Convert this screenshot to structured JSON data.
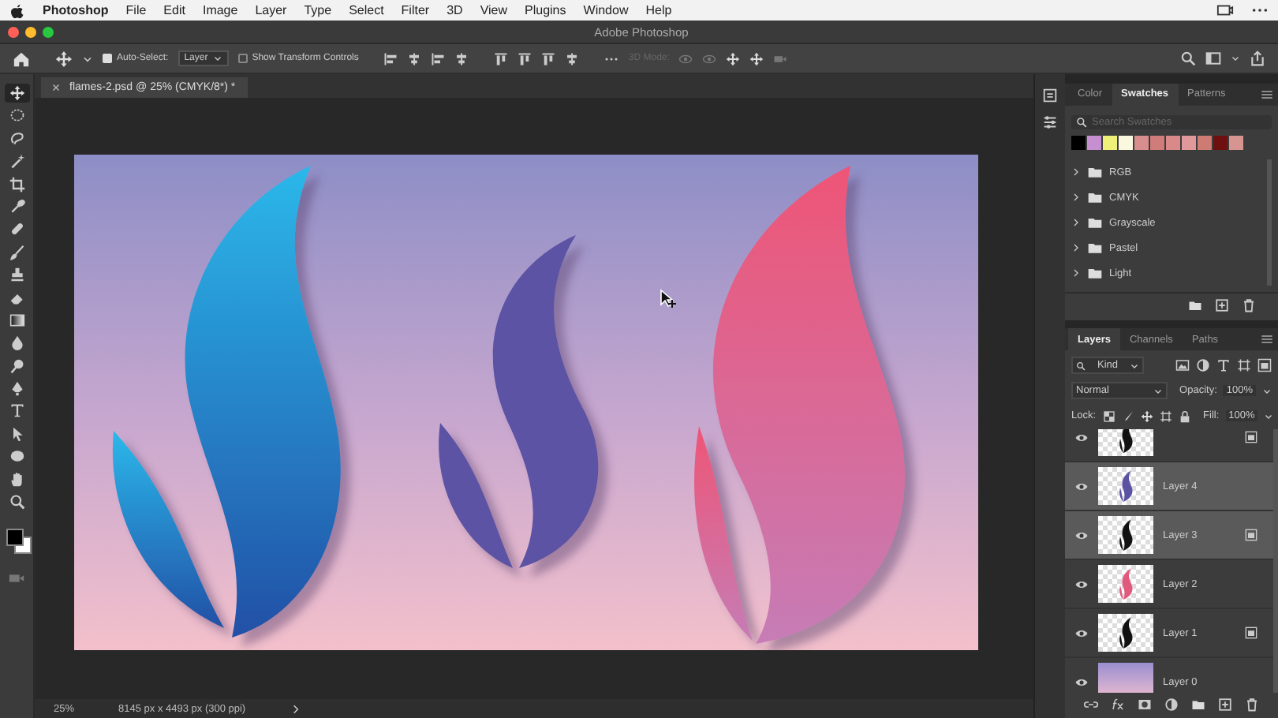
{
  "menu_bar": {
    "app_name": "Photoshop",
    "items": [
      "File",
      "Edit",
      "Image",
      "Layer",
      "Type",
      "Select",
      "Filter",
      "3D",
      "View",
      "Plugins",
      "Window",
      "Help"
    ]
  },
  "window": {
    "title": "Adobe Photoshop"
  },
  "options_bar": {
    "auto_select": {
      "label": "Auto-Select:",
      "checked": true
    },
    "target": "Layer",
    "transform_controls": {
      "label": "Show Transform Controls",
      "checked": false
    },
    "mode_3d": {
      "label": "3D Mode:",
      "disabled": true
    }
  },
  "tools": [
    {
      "kind": "move",
      "selected": true
    },
    {
      "kind": "marquee",
      "selected": false
    },
    {
      "kind": "lasso",
      "selected": false
    },
    {
      "kind": "wand",
      "selected": false
    },
    {
      "kind": "crop",
      "selected": false
    },
    {
      "kind": "eyedropper",
      "selected": false
    },
    {
      "kind": "bandage",
      "selected": false
    },
    {
      "kind": "brush",
      "selected": false
    },
    {
      "kind": "stamp",
      "selected": false
    },
    {
      "kind": "eraser",
      "selected": false
    },
    {
      "kind": "gradient",
      "selected": false
    },
    {
      "kind": "drop",
      "selected": false
    },
    {
      "kind": "dodge",
      "selected": false
    },
    {
      "kind": "pen",
      "selected": false
    },
    {
      "kind": "type",
      "selected": false
    },
    {
      "kind": "arrow",
      "selected": false
    },
    {
      "kind": "ellipse",
      "selected": false
    },
    {
      "kind": "hand",
      "selected": false
    },
    {
      "kind": "zoom",
      "selected": false
    }
  ],
  "document": {
    "tab_title": "flames-2.psd @ 25% (CMYK/8*) *"
  },
  "swatches_panel": {
    "tabs": [
      {
        "label": "Color",
        "selected": false
      },
      {
        "label": "Swatches",
        "selected": true
      },
      {
        "label": "Patterns",
        "selected": false
      }
    ],
    "search": {
      "placeholder": "Search Swatches"
    },
    "swatches": [
      {
        "color": "#000000"
      },
      {
        "color": "#c58fd0"
      },
      {
        "color": "#eef07a"
      },
      {
        "color": "#fbf8e0"
      },
      {
        "color": "#d88e8e"
      },
      {
        "color": "#d07c7a"
      },
      {
        "color": "#d98a88"
      },
      {
        "color": "#e1989a"
      },
      {
        "color": "#cd7b73"
      },
      {
        "color": "#6e1010"
      },
      {
        "color": "#d69590"
      }
    ],
    "groups": [
      {
        "name": "RGB",
        "expanded": false
      },
      {
        "name": "CMYK",
        "expanded": false
      },
      {
        "name": "Grayscale",
        "expanded": false
      },
      {
        "name": "Pastel",
        "expanded": false
      },
      {
        "name": "Light",
        "expanded": false
      }
    ]
  },
  "layers_panel": {
    "tabs": [
      {
        "label": "Layers",
        "selected": true
      },
      {
        "label": "Channels",
        "selected": false
      },
      {
        "label": "Paths",
        "selected": false
      }
    ],
    "filter": "Kind",
    "blend_mode": "Normal",
    "opacity": {
      "label": "Opacity:",
      "value": "100%"
    },
    "lock_label": "Lock:",
    "fill": {
      "label": "Fill:",
      "value": "100%"
    },
    "layers": [
      {
        "kind": "dark-flame",
        "visible": true,
        "selected": false,
        "smart_object": true
      },
      {
        "name": "Layer 4",
        "kind": "purple-flame",
        "visible": true,
        "selected": true,
        "smart_object": false
      },
      {
        "name": "Layer 3",
        "kind": "dark-flame",
        "visible": true,
        "selected": true,
        "smart_object": true
      },
      {
        "name": "Layer 2",
        "kind": "pink-flame",
        "visible": true,
        "selected": false,
        "smart_object": false
      },
      {
        "name": "Layer 1",
        "kind": "dark-flame",
        "visible": true,
        "selected": false,
        "smart_object": true
      },
      {
        "name": "Layer 0",
        "kind": "gradient",
        "visible": true,
        "selected": false,
        "smart_object": false
      }
    ]
  },
  "status_bar": {
    "zoom": "25%",
    "document_info": "8145 px x 4493 px (300 ppi)"
  }
}
